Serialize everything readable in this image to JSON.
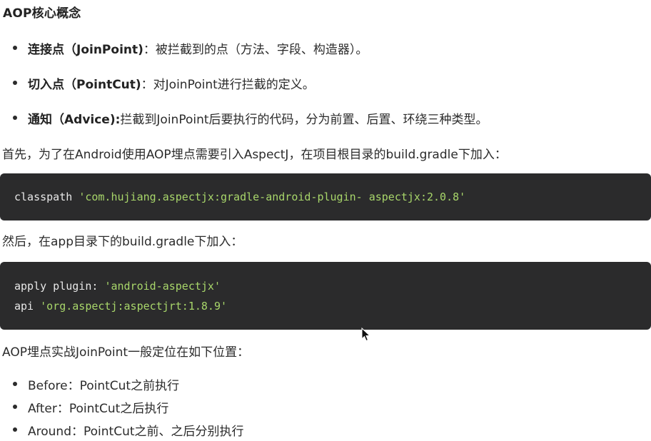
{
  "heading": "AOP核心概念",
  "concepts": [
    {
      "term": "连接点（JoinPoint)",
      "desc": "：被拦截到的点（方法、字段、构造器）。"
    },
    {
      "term": "切入点（PointCut)",
      "desc": "：对JoinPoint进行拦截的定义。"
    },
    {
      "term": "通知（Advice):",
      "desc": "拦截到JoinPoint后要执行的代码，分为前置、后置、环绕三种类型。"
    }
  ],
  "para1": "首先，为了在Android使用AOP埋点需要引入AspectJ，在项目根目录的build.gradle下加入：",
  "code1": {
    "keyword": "classpath ",
    "string": "'com.hujiang.aspectjx:gradle-android-plugin- aspectjx:2.0.8'"
  },
  "para2": "然后，在app目录下的build.gradle下加入：",
  "code2": {
    "line1_keyword": "apply plugin: ",
    "line1_string": "'android-aspectjx'",
    "line2_keyword": "api ",
    "line2_string": "'org.aspectj:aspectjrt:1.8.9'"
  },
  "para3": "AOP埋点实战JoinPoint一般定位在如下位置：",
  "positions": [
    "Before：PointCut之前执行",
    "After：PointCut之后执行",
    "Around：PointCut之前、之后分别执行"
  ],
  "colors": {
    "code_bg": "#2b2b2c",
    "code_text": "#e8e8e8",
    "code_string": "#a8d66a"
  }
}
